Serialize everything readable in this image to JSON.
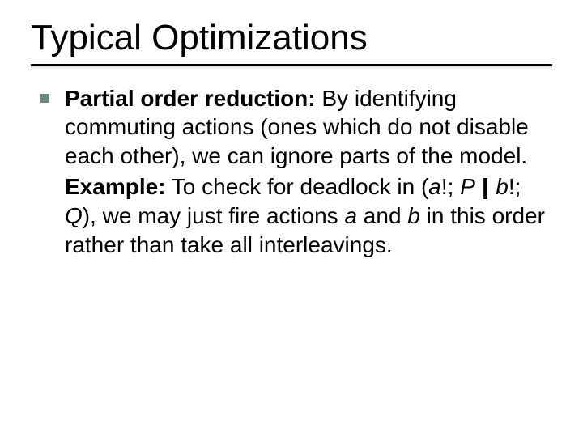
{
  "slide": {
    "title": "Typical Optimizations",
    "bullet": {
      "lead": "Partial order reduction:",
      "rest": " By identifying commuting actions (ones which do not disable each other), we can ignore parts of the model."
    },
    "example": {
      "lead": "Example:",
      "part1": " To check for deadlock in (",
      "a": "a",
      "part2": "!; ",
      "P": "P",
      "parallel": "|||",
      "space": " ",
      "b": "b",
      "part3": "!; ",
      "Q": "Q",
      "part4": "), we may just fire actions ",
      "a2": "a",
      "part5": " and ",
      "b2": "b",
      "part6": " in this order rather than take all interleavings."
    }
  }
}
